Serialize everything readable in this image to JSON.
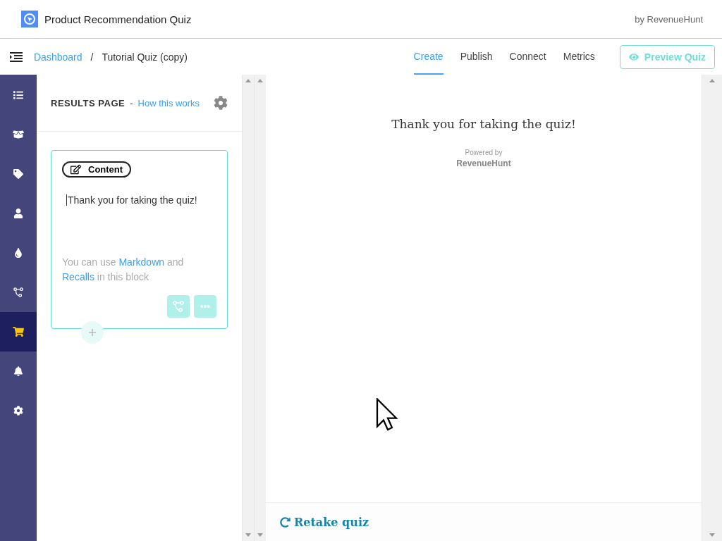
{
  "header": {
    "title": "Product Recommendation Quiz",
    "byline": "by RevenueHunt"
  },
  "breadcrumb": [
    {
      "label": "Dashboard",
      "kind": "link"
    },
    {
      "label": "/",
      "kind": "separator"
    },
    {
      "label": "Tutorial Quiz (copy)",
      "kind": "current"
    }
  ],
  "tabs": [
    {
      "label": "Create",
      "selected": true
    },
    {
      "label": "Publish",
      "selected": false
    },
    {
      "label": "Connect",
      "selected": false
    },
    {
      "label": "Metrics",
      "selected": false
    }
  ],
  "preview_button": "Preview Quiz",
  "sidebar": {
    "items": [
      {
        "kind": "list",
        "selected": false
      },
      {
        "kind": "box",
        "selected": false
      },
      {
        "kind": "tag",
        "selected": false
      },
      {
        "kind": "user",
        "selected": false
      },
      {
        "kind": "drop",
        "selected": false
      },
      {
        "kind": "flow",
        "selected": false
      },
      {
        "kind": "cart",
        "selected": true
      },
      {
        "kind": "bell",
        "selected": false
      },
      {
        "kind": "gear",
        "selected": false
      }
    ]
  },
  "panel": {
    "title": "RESULTS PAGE",
    "separator": "-",
    "help_link": "How this works",
    "block": {
      "badge": "Content",
      "text": "Thank you for taking the quiz!",
      "hint": [
        {
          "kind": "text",
          "text": "You can use "
        },
        {
          "kind": "link",
          "text": "Markdown"
        },
        {
          "kind": "text",
          "text": " and "
        },
        {
          "kind": "link",
          "text": "Recalls"
        },
        {
          "kind": "text",
          "text": " in this block"
        }
      ]
    }
  },
  "preview": {
    "message": "Thank you for taking the quiz!",
    "powered_by": "Powered by",
    "brand": "RevenueHunt",
    "retake": "Retake quiz"
  }
}
